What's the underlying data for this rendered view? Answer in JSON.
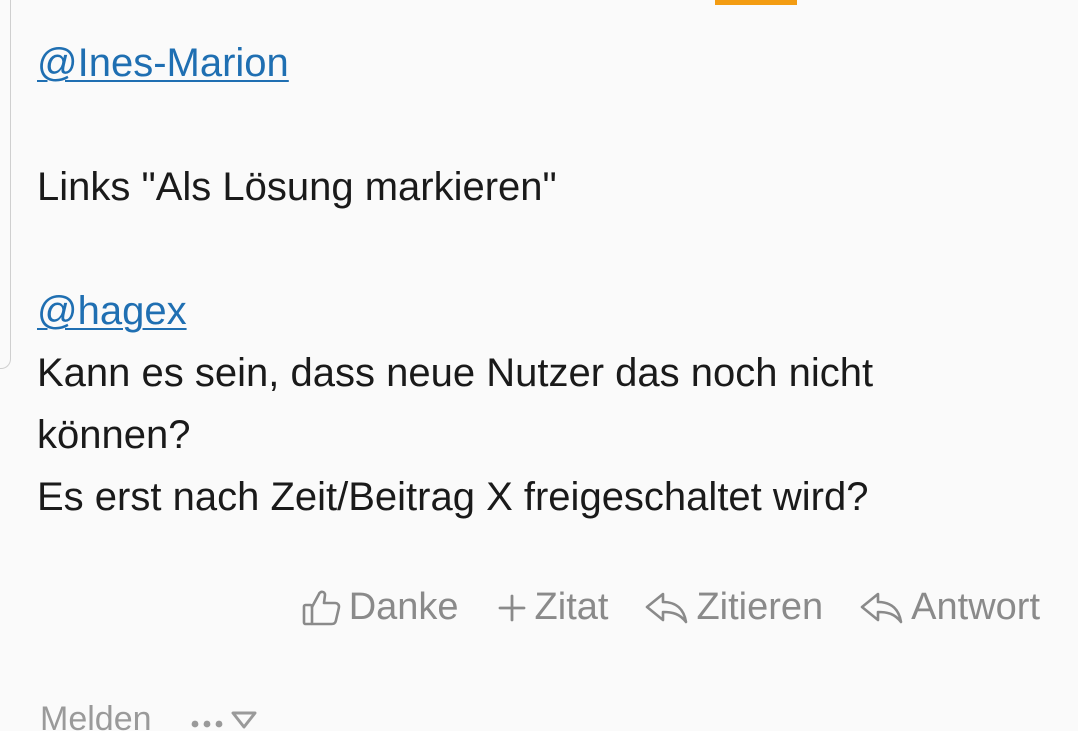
{
  "post": {
    "mention_1": "@Ines-Marion",
    "line_1": "Links \"Als Lösung markieren\"",
    "mention_2": "@hagex",
    "line_2": "Kann es sein, dass neue Nutzer das noch nicht",
    "line_3": "können?",
    "line_4": "Es erst nach Zeit/Beitrag X freigeschaltet wird?"
  },
  "actions": {
    "thanks_label": "Danke",
    "quote_plus_label": "Zitat",
    "quote_label": "Zitieren",
    "reply_label": "Antwort"
  },
  "footer": {
    "report_label": "Melden",
    "more_icon": "ellipsis-icon",
    "expand_icon": "chevron-down-icon"
  },
  "colors": {
    "accent_orange": "#f39c12",
    "link_blue": "#1f6fb2",
    "action_gray": "#8a8a8a"
  }
}
